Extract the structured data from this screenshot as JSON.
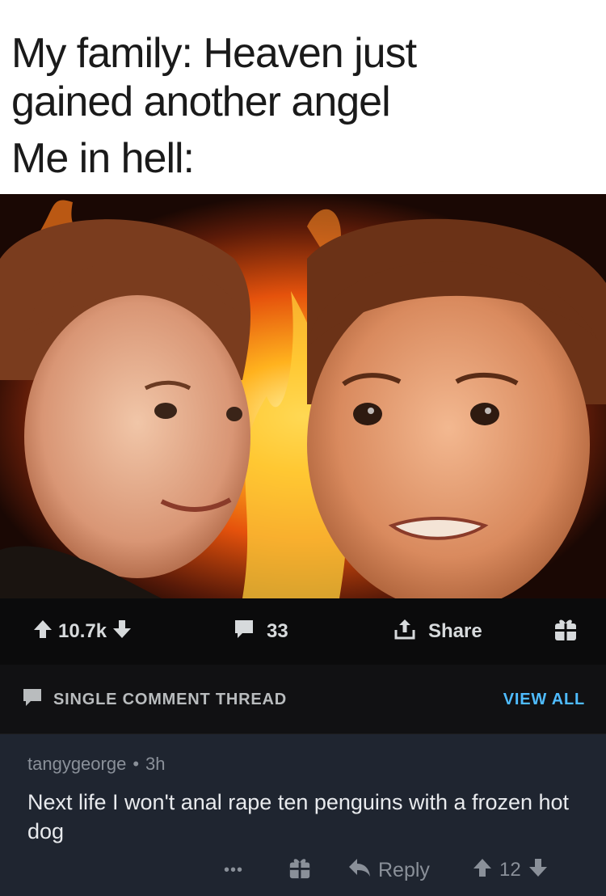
{
  "meme": {
    "caption_line_1": "My family: Heaven just",
    "caption_line_2": "gained another angel",
    "caption_line_3": "Me in hell:"
  },
  "post_actions": {
    "score": "10.7k",
    "comment_count": "33",
    "share_label": "Share",
    "icons": [
      "upvote-arrow-icon",
      "downvote-arrow-icon",
      "comment-bubble-icon",
      "share-icon",
      "gift-icon"
    ]
  },
  "thread": {
    "label": "SINGLE COMMENT THREAD",
    "view_all": "VIEW ALL"
  },
  "comment": {
    "author": "tangygeorge",
    "separator": "•",
    "age": "3h",
    "text": "Next life I won't anal rape ten penguins with a frozen hot dog",
    "more": "•••",
    "reply_label": "Reply",
    "score": "12"
  },
  "colors": {
    "accent_link": "#4fbcff",
    "comment_bg": "#1f2530",
    "action_bar_bg": "#0b0b0c"
  }
}
